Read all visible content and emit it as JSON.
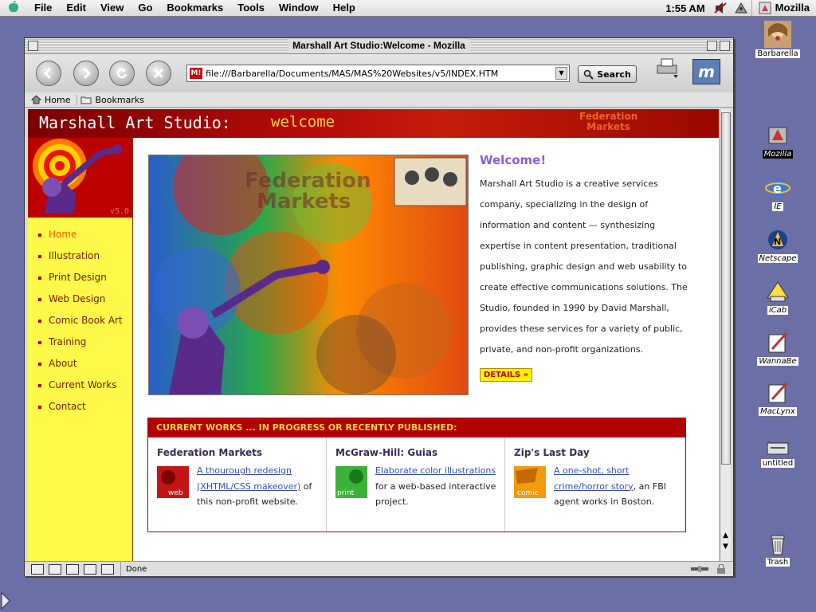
{
  "menubar": {
    "items": [
      "File",
      "Edit",
      "View",
      "Go",
      "Bookmarks",
      "Tools",
      "Window",
      "Help"
    ],
    "clock": "1:55 AM",
    "app_name": "Mozilla"
  },
  "window": {
    "title": "Marshall Art Studio:Welcome - Mozilla",
    "url": "file:///Barbarella/Documents/MAS/MAS%20Websites/v5/INDEX.HTM",
    "search_label": "Search",
    "personal_toolbar": [
      "Home",
      "Bookmarks"
    ],
    "status": "Done"
  },
  "page": {
    "banner_site": "Marshall Art Studio:",
    "banner_welcome": "welcome",
    "banner_fed": "Federation\nMarkets",
    "logo_version": "v5.0",
    "nav": [
      "Home",
      "Illustration",
      "Print Design",
      "Web Design",
      "Comic Book Art",
      "Training",
      "About",
      "Current Works",
      "Contact"
    ],
    "intro": {
      "heading": "Welcome!",
      "body": "Marshall Art Studio is a creative services company, specializing in the design of information and content — synthesizing expertise in content presentation, traditional publishing, graphic design and web usability to create effective communications solutions. The Studio, founded in 1990 by David Marshall, provides these services for a variety of public, private, and non-profit organizations.",
      "details": "DETAILS »"
    },
    "works": {
      "header": "CURRENT WORKS ... IN PROGRESS OR RECENTLY PUBLISHED:",
      "items": [
        {
          "title": "Federation Markets",
          "link": "A thourough redesign (XHTML/CSS makeover)",
          "rest": " of this non-profit website.",
          "thumb_label": "web"
        },
        {
          "title": "McGraw-Hill: Guias",
          "link": "Elaborate color illustrations",
          "rest": " for a web-based interactive project.",
          "thumb_label": "print"
        },
        {
          "title": "Zip's Last Day",
          "link": "A one-shot, short crime/horror story",
          "rest": ", an FBI agent works in Boston.",
          "thumb_label": "comic"
        }
      ]
    }
  },
  "desktop": {
    "icons": [
      "Barbarella",
      "Mozilla",
      "IE",
      "Netscape",
      "iCab",
      "WannaBe",
      "MacLynx",
      "untitled",
      "Trash"
    ]
  },
  "colors": {
    "desktop": "#6b6fa6",
    "banner_red": "#b40a0a",
    "sidebar_yellow": "#fff94a",
    "accent_purple": "#8a5cd6",
    "link_blue": "#3350b0"
  }
}
